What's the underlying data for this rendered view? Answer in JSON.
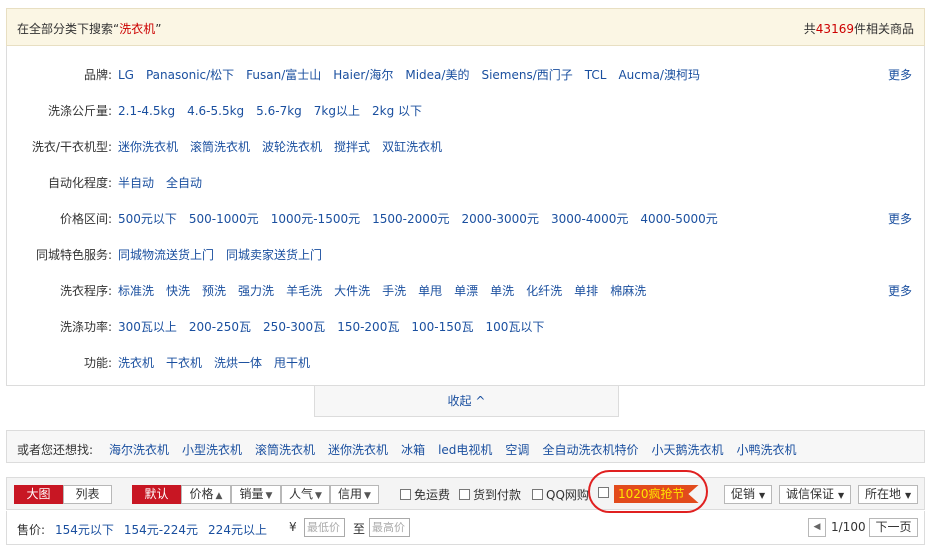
{
  "header": {
    "search_prefix": "在全部分类下搜索",
    "quote_open": "“",
    "keyword": "洗衣机",
    "quote_close": "”",
    "count_prefix": "共",
    "count": "43169",
    "count_suffix": "件相关商品"
  },
  "filters": [
    {
      "label": "品牌:",
      "options": [
        "LG",
        "Panasonic/松下",
        "Fusan/富士山",
        "Haier/海尔",
        "Midea/美的",
        "Siemens/西门子",
        "TCL",
        "Aucma/澳柯玛"
      ],
      "more": "更多"
    },
    {
      "label": "洗涤公斤量:",
      "options": [
        "2.1-4.5kg",
        "4.6-5.5kg",
        "5.6-7kg",
        "7kg以上",
        "2kg 以下"
      ],
      "more": ""
    },
    {
      "label": "洗衣/干衣机型:",
      "options": [
        "迷你洗衣机",
        "滚筒洗衣机",
        "波轮洗衣机",
        "搅拌式",
        "双缸洗衣机"
      ],
      "more": ""
    },
    {
      "label": "自动化程度:",
      "options": [
        "半自动",
        "全自动"
      ],
      "more": ""
    },
    {
      "label": "价格区间:",
      "options": [
        "500元以下",
        "500-1000元",
        "1000元-1500元",
        "1500-2000元",
        "2000-3000元",
        "3000-4000元",
        "4000-5000元"
      ],
      "more": "更多"
    },
    {
      "label": "同城特色服务:",
      "options": [
        "同城物流送货上门",
        "同城卖家送货上门"
      ],
      "more": ""
    },
    {
      "label": "洗衣程序:",
      "options": [
        "标准洗",
        "快洗",
        "预洗",
        "强力洗",
        "羊毛洗",
        "大件洗",
        "手洗",
        "单甩",
        "单漂",
        "单洗",
        "化纤洗",
        "单排",
        "棉麻洗"
      ],
      "more": "更多"
    },
    {
      "label": "洗涤功率:",
      "options": [
        "300瓦以上",
        "200-250瓦",
        "250-300瓦",
        "150-200瓦",
        "100-150瓦",
        "100瓦以下"
      ],
      "more": ""
    },
    {
      "label": "功能:",
      "options": [
        "洗衣机",
        "干衣机",
        "洗烘一体",
        "甩干机"
      ],
      "more": ""
    }
  ],
  "collapse": {
    "label": "收起",
    "arrow": "^"
  },
  "related": {
    "label": "或者您还想找:",
    "items": [
      "海尔洗衣机",
      "小型洗衣机",
      "滚筒洗衣机",
      "迷你洗衣机",
      "冰箱",
      "led电视机",
      "空调",
      "全自动洗衣机特价",
      "小天鹅洗衣机",
      "小鸭洗衣机"
    ]
  },
  "toolbar": {
    "view_big": "大图",
    "view_list": "列表",
    "sort_default": "默认",
    "sort_price": "价格",
    "sort_sales": "销量",
    "sort_popularity": "人气",
    "sort_credit": "信用",
    "cb_free_shipping": "免运费",
    "cb_cod": "货到付款",
    "cb_qq": "QQ网购",
    "promo": "1020疯抢节",
    "dd_promo": "促销",
    "dd_guarantee": "诚信保证",
    "dd_location": "所在地"
  },
  "pricebar": {
    "label": "售价:",
    "options": [
      "154元以下",
      "154元-224元",
      "224元以上"
    ],
    "yen": "¥",
    "min_placeholder": "最低价",
    "to": "至",
    "max_placeholder": "最高价",
    "page": "1/100",
    "next": "下一页"
  },
  "colors": {
    "accent_red": "#c81623",
    "link_blue": "#1a4f9f",
    "promo_bg": "#e24b1c",
    "highlight_circle": "#e02020"
  }
}
